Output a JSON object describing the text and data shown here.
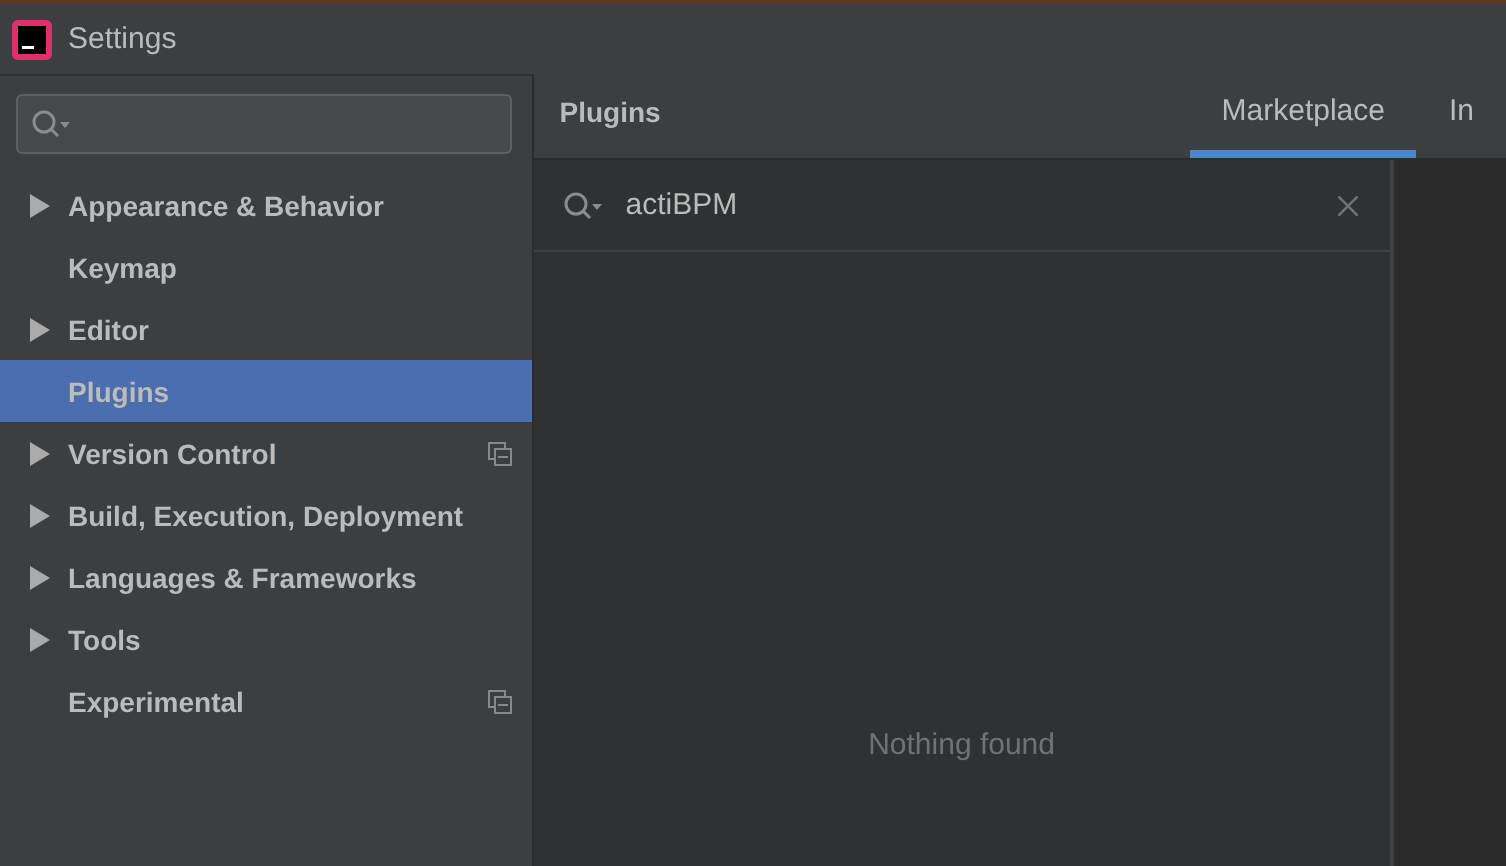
{
  "window": {
    "title": "Settings"
  },
  "sidebar": {
    "items": [
      {
        "label": "Appearance & Behavior",
        "kind": "group",
        "selected": false,
        "project_scoped": false
      },
      {
        "label": "Keymap",
        "kind": "leaf",
        "selected": false,
        "project_scoped": false
      },
      {
        "label": "Editor",
        "kind": "group",
        "selected": false,
        "project_scoped": false
      },
      {
        "label": "Plugins",
        "kind": "leaf",
        "selected": true,
        "project_scoped": false
      },
      {
        "label": "Version Control",
        "kind": "group",
        "selected": false,
        "project_scoped": true
      },
      {
        "label": "Build, Execution, Deployment",
        "kind": "group",
        "selected": false,
        "project_scoped": false
      },
      {
        "label": "Languages & Frameworks",
        "kind": "group",
        "selected": false,
        "project_scoped": false
      },
      {
        "label": "Tools",
        "kind": "group",
        "selected": false,
        "project_scoped": false
      },
      {
        "label": "Experimental",
        "kind": "leaf",
        "selected": false,
        "project_scoped": true
      }
    ]
  },
  "panel": {
    "title": "Plugins",
    "tabs": [
      {
        "label": "Marketplace",
        "selected": true
      },
      {
        "label": "In",
        "selected": false
      }
    ],
    "search": {
      "value": "actiBPM"
    },
    "message": "Nothing found"
  }
}
